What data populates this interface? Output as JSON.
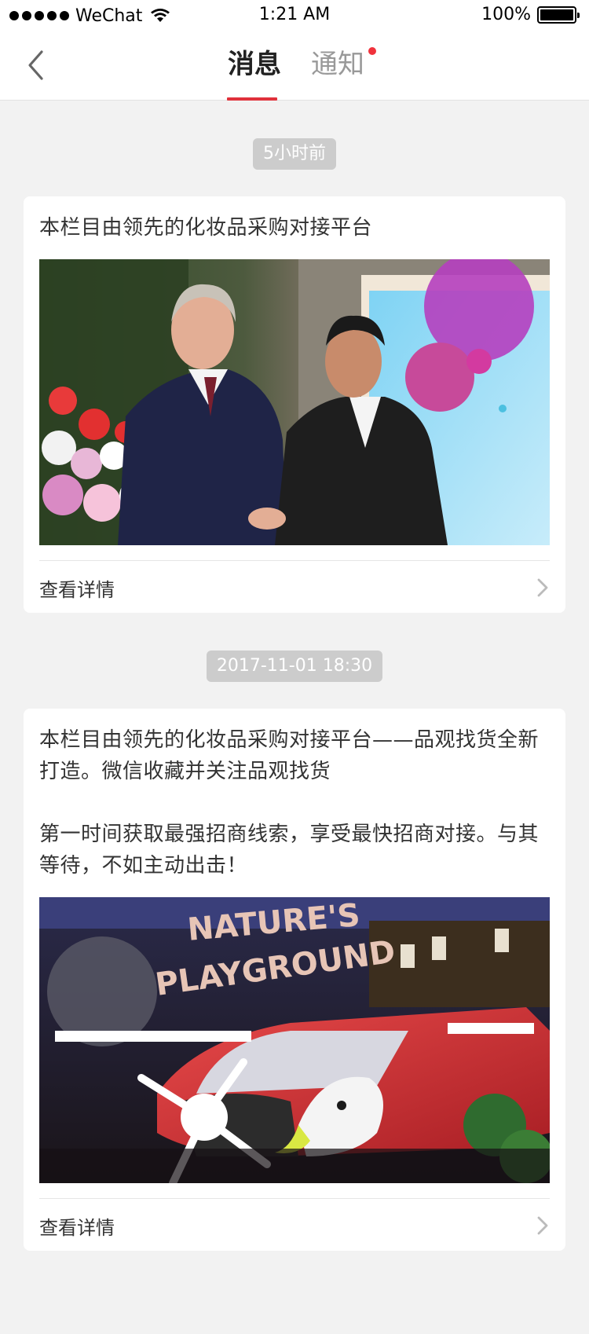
{
  "status_bar": {
    "carrier": "WeChat",
    "time": "1:21 AM",
    "battery": "100%"
  },
  "nav": {
    "tabs": [
      {
        "label": "消息",
        "active": true
      },
      {
        "label": "通知",
        "active": false,
        "has_unread_dot": true
      }
    ],
    "accent_color": "#e0313b"
  },
  "messages": [
    {
      "timestamp": "5小时前",
      "text": "本栏目由领先的化妆品采购对接平台",
      "image": "photo-two-men-handshake",
      "link_label": "查看详情"
    },
    {
      "timestamp": "2017-11-01  18:30",
      "text": "本栏目由领先的化妆品采购对接平台——品观找货全新打造。微信收藏并关注品观找货\n\n第一时间获取最强招商线索，享受最快招商对接。与其等待，不如主动出击！",
      "image": "photo-natures-playground-airplane",
      "image_caption": "NATURE'S PLAYGROUND",
      "link_label": "查看详情"
    }
  ]
}
